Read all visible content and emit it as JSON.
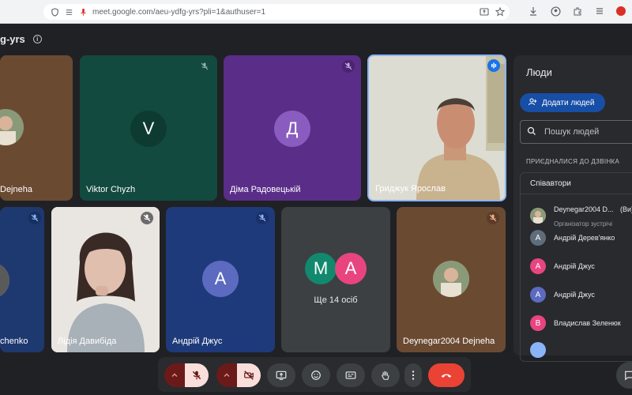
{
  "browser": {
    "url": "meet.google.com/aeu-ydfg-yrs?pli=1&authuser=1"
  },
  "meeting": {
    "code_partial": "g-yrs"
  },
  "tiles": {
    "t1_name": "Dejneha",
    "t2_name": "Viktor Chyzh",
    "t2_letter": "V",
    "t3_name": "Діма Радовецькій",
    "t3_letter": "Д",
    "t4_name": "Гриджук Ярослав",
    "t5_name": "chenko",
    "t6_name": "Лідія Давибіда",
    "t7_name": "Андрій Джус",
    "t7_letter": "А",
    "t8_letter_a": "М",
    "t8_letter_b": "А",
    "t8_more": "Ще 14 осіб",
    "t9_name": "Deynegar2004 Dejneha"
  },
  "panel": {
    "title": "Люди",
    "add_label": "Додати людей",
    "search_placeholder": "Пошук людей",
    "section": "ПРИЄДНАЛИСЯ ДО ДЗВІНКА",
    "contributors": "Співавтори",
    "people": [
      {
        "name": "Deynegar2004 D...",
        "suffix": "(Ви)",
        "sub": "Організатор зустрічі"
      },
      {
        "name": "Андрій Дерев'янко",
        "letter": "А",
        "color": "#5f6d7a"
      },
      {
        "name": "Андрій Джус",
        "letter": "А",
        "color": "#e8457f"
      },
      {
        "name": "Андрій Джус",
        "letter": "А",
        "color": "#5c6bc0"
      },
      {
        "name": "Владислав Зеленюк",
        "letter": "В",
        "color": "#e8457f"
      }
    ]
  },
  "colors": {
    "meet_bg": "#202124",
    "tile_brown": "#6d4c34",
    "tile_green": "#134d40",
    "tile_purple": "#5b2e8a",
    "tile_navy": "#1f3a7a",
    "end_call": "#ea4335"
  }
}
